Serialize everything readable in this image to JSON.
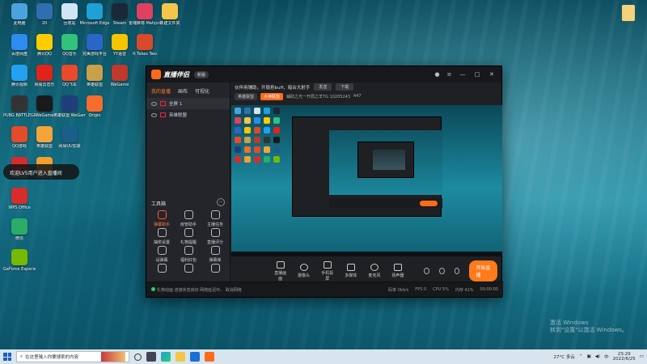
{
  "desktop": {
    "icons": [
      {
        "label": "此电脑",
        "color": "#4aa3df",
        "col": 0,
        "row": 0
      },
      {
        "label": "20",
        "color": "#2f6fb0",
        "col": 1,
        "row": 0
      },
      {
        "label": "回收站",
        "color": "#cfe6f7",
        "col": 2,
        "row": 0
      },
      {
        "label": "Microsoft Edge",
        "color": "#1fa0d8",
        "col": 3,
        "row": 0
      },
      {
        "label": "Steam",
        "color": "#1b2838",
        "col": 4,
        "row": 0
      },
      {
        "label": "雀魂麻将 Mahjong...",
        "color": "#e04060",
        "col": 5,
        "row": 0
      },
      {
        "label": "新建文件夹",
        "color": "#f3c54a",
        "col": 6,
        "row": 0
      },
      {
        "label": "百度网盘",
        "color": "#2d8cf0",
        "col": 0,
        "row": 1
      },
      {
        "label": "腾讯QQ",
        "color": "#ffcc00",
        "col": 1,
        "row": 1
      },
      {
        "label": "QQ音乐",
        "color": "#31c27c",
        "col": 2,
        "row": 1
      },
      {
        "label": "完美游戏平台",
        "color": "#2a66c8",
        "col": 3,
        "row": 1
      },
      {
        "label": "YY语音",
        "color": "#f7c400",
        "col": 4,
        "row": 1
      },
      {
        "label": "It Takes Two",
        "color": "#d94a2a",
        "col": 5,
        "row": 1
      },
      {
        "label": "腾讯视频",
        "color": "#22a1f0",
        "col": 0,
        "row": 2
      },
      {
        "label": "网易云音乐",
        "color": "#e2231a",
        "col": 1,
        "row": 2
      },
      {
        "label": "QQ飞车",
        "color": "#e84a2a",
        "col": 2,
        "row": 2
      },
      {
        "label": "英雄联盟",
        "color": "#c9a04a",
        "col": 3,
        "row": 2
      },
      {
        "label": "WeGame",
        "color": "#c0392b",
        "col": 4,
        "row": 2
      },
      {
        "label": "PUBG BATTLEGR...",
        "color": "#333333",
        "col": 0,
        "row": 3
      },
      {
        "label": "WeGame",
        "color": "#1a1a1a",
        "col": 1,
        "row": 3
      },
      {
        "label": "英雄联盟 WeGame版",
        "color": "#1f3f7a",
        "col": 2,
        "row": 3
      },
      {
        "label": "Origin",
        "color": "#f56c2d",
        "col": 3,
        "row": 3
      },
      {
        "label": "QQ游戏",
        "color": "#e34b2a",
        "col": 0,
        "row": 4
      },
      {
        "label": "英雄联盟",
        "color": "#f3a43a",
        "col": 1,
        "row": 4
      },
      {
        "label": "网易UU加速",
        "color": "#1a5f8a",
        "col": 2,
        "row": 4
      },
      {
        "label": "神经转接",
        "color": "#d82c2c",
        "col": 0,
        "row": 5
      },
      {
        "label": "英雄联盟",
        "color": "#f0a030",
        "col": 1,
        "row": 5
      },
      {
        "label": "WPS Office",
        "color": "#d82c2c",
        "col": 0,
        "row": 6
      },
      {
        "label": "微信",
        "color": "#2aae67",
        "col": 0,
        "row": 7
      },
      {
        "label": "GeForce Experience",
        "color": "#76b900",
        "col": 0,
        "row": 8
      }
    ],
    "toast": "欢迎LV5用户进入直播间",
    "top_right_file": "",
    "watermark_title": "激活 Windows",
    "watermark_sub": "转到\"设置\"以激活 Windows。"
  },
  "app": {
    "brand": "直播伴侣",
    "version_badge": "新版",
    "left_tabs": [
      "我的直播",
      "画布",
      "可视化"
    ],
    "scenes": [
      {
        "label": "全屏 1"
      },
      {
        "label": "英雄联盟"
      }
    ],
    "tools_title": "工具箱",
    "tools": [
      {
        "label": "弹幕助手",
        "hot": true
      },
      {
        "label": "房管助手",
        "hot": false
      },
      {
        "label": "主播任务",
        "hot": false
      },
      {
        "label": "抽奖设置",
        "hot": false
      },
      {
        "label": "礼物提醒",
        "hot": false
      },
      {
        "label": "直播评分",
        "hot": false
      },
      {
        "label": "设弹幕",
        "hot": false
      },
      {
        "label": "福利红包",
        "hot": false
      },
      {
        "label": "弹幕库",
        "hot": false
      },
      {
        "label": "",
        "hot": false
      },
      {
        "label": "",
        "hot": false
      },
      {
        "label": "",
        "hot": false
      }
    ],
    "notice_text": "伙伴用辅助，开局抢buff，暗合大射手",
    "notice_chip": "发送",
    "notice_chip2": "下载",
    "sub_tags": [
      "英雄联盟",
      "大神联盟"
    ],
    "sub_text": "辅助之光一开局之羊TG  10205243",
    "sub_count": "447",
    "controls": [
      {
        "label": "直播画面",
        "round": false
      },
      {
        "label": "摄像头",
        "round": true
      },
      {
        "label": "手机投屏",
        "round": false
      },
      {
        "label": "多媒体",
        "round": false
      },
      {
        "label": "麦克风",
        "round": true
      },
      {
        "label": "扬声器",
        "round": false
      }
    ],
    "start_button": "开始直播",
    "status_text": "礼物动画  连接状态良好 网络延迟中。 取消网络",
    "status_metrics": [
      "码率 0kb/s",
      "FPS 0",
      "CPU 5%",
      "内存 41%"
    ],
    "status_time": "00:00:00"
  },
  "taskbar": {
    "search_placeholder": "在这里输入你要搜索的内容",
    "weather": "27°C 多云",
    "time": "23:29",
    "date": "2022/6/25",
    "ime": "中"
  }
}
